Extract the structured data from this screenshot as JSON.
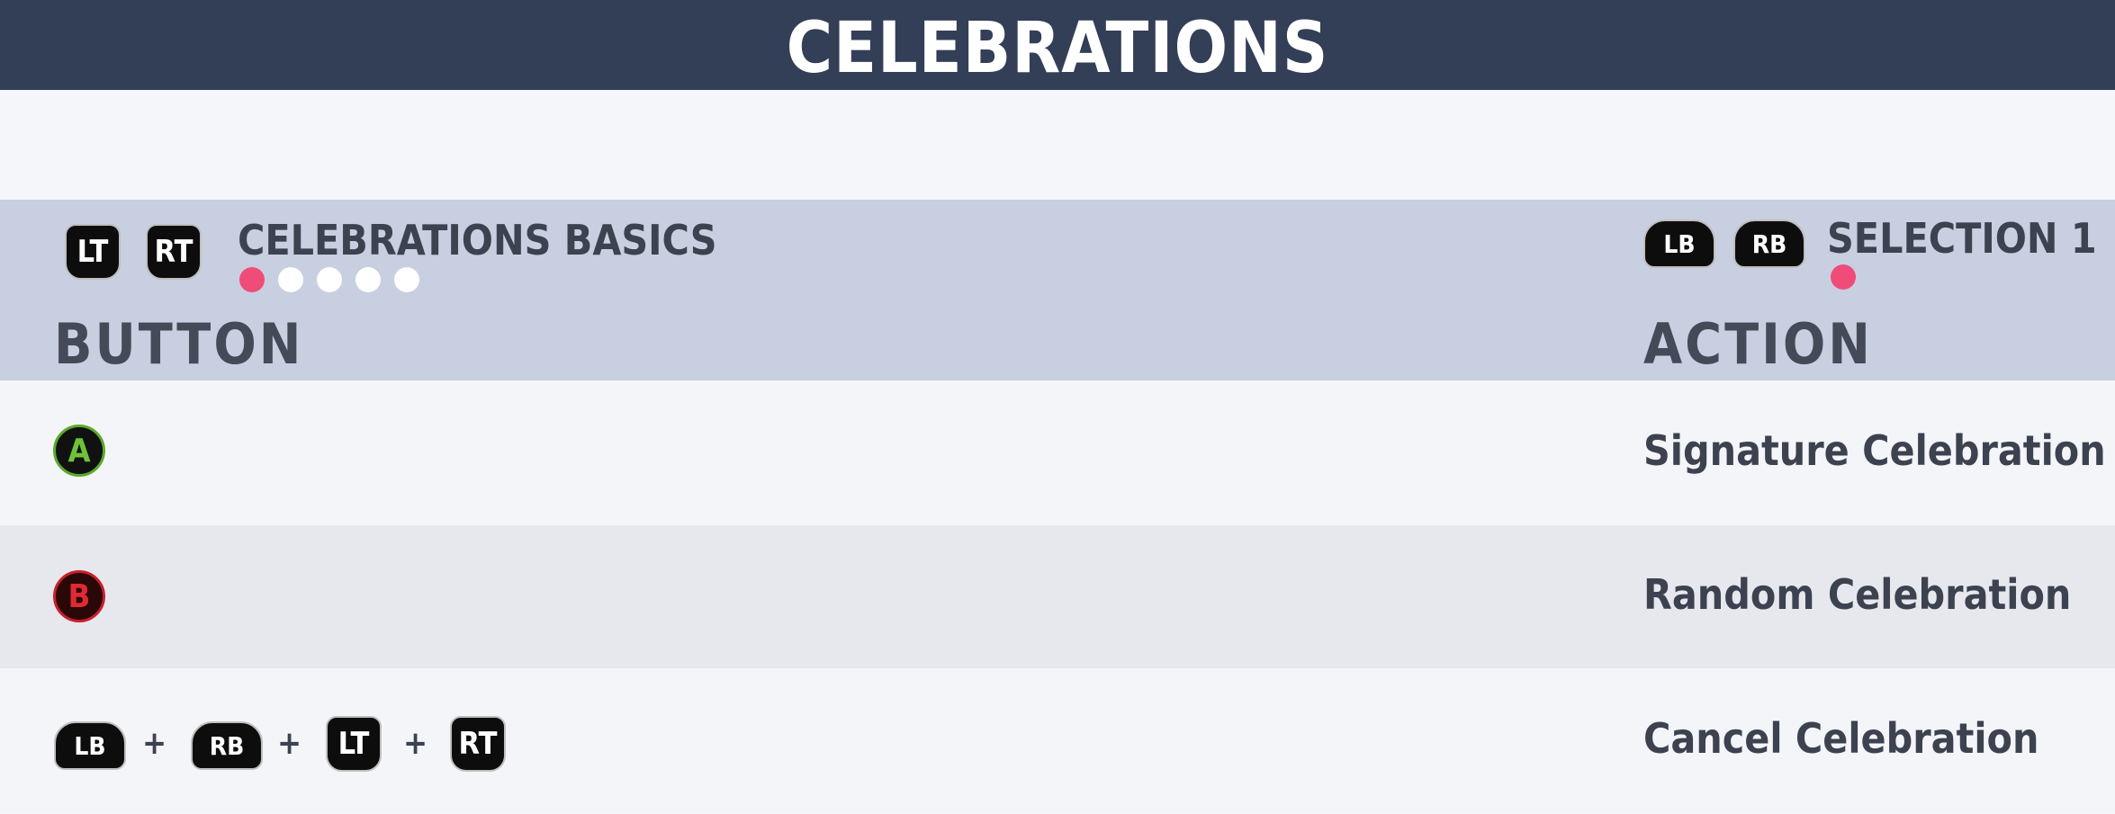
{
  "title": "CELEBRATIONS",
  "left_tabs": {
    "buttons": [
      "LT",
      "RT"
    ],
    "label": "CELEBRATIONS BASICS",
    "pages": 5,
    "active_page": 1
  },
  "right_tabs": {
    "buttons": [
      "LB",
      "RB"
    ],
    "label": "SELECTION 1",
    "pages": 1,
    "active_page": 1
  },
  "columns": {
    "button": "BUTTON",
    "action": "ACTION"
  },
  "rows": [
    {
      "buttons": [
        "A"
      ],
      "action": "Signature Celebration"
    },
    {
      "buttons": [
        "B"
      ],
      "action": "Random Celebration"
    },
    {
      "buttons": [
        "LB",
        "RB",
        "LT",
        "RT"
      ],
      "separator": "+",
      "action": "Cancel Celebration"
    }
  ],
  "colors": {
    "title_bar": "#333e57",
    "header_band": "#c8cfe0",
    "active_dot": "#f04c7a",
    "a_button": "#6ec23a",
    "b_button": "#e02a33"
  }
}
